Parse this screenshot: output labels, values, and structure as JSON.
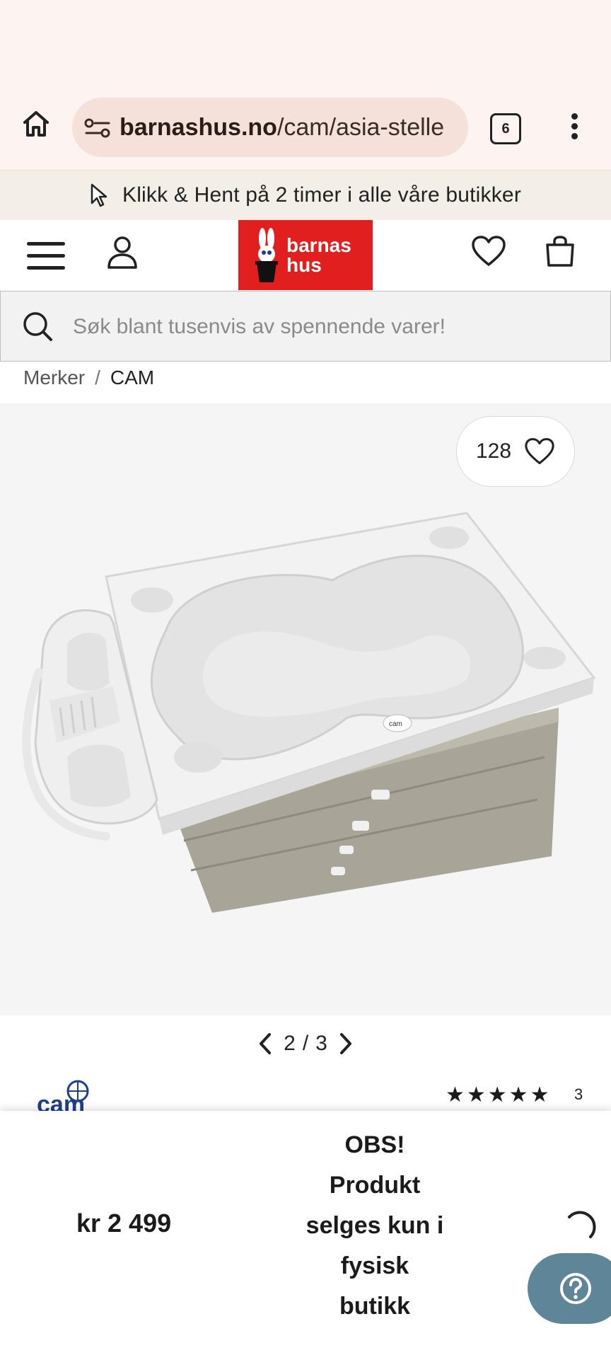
{
  "browser": {
    "url_host": "barnashus.no",
    "url_path": "/cam/asia-stelle",
    "tab_count": "6"
  },
  "promo": {
    "text": "Klikk & Hent på 2 timer i alle våre butikker"
  },
  "header": {
    "logo_line1": "barnas",
    "logo_line2": "hus"
  },
  "search": {
    "placeholder": "Søk blant tusenvis av spennende varer!"
  },
  "breadcrumb": {
    "items": [
      "Merker",
      "CAM"
    ],
    "separator": "/"
  },
  "product": {
    "favorites_count": "128",
    "pager_current": "2",
    "pager_separator": "/",
    "pager_total": "3",
    "brand": "cam",
    "rating_stars": "★★★★★",
    "rating_value": 5,
    "rating_count": "3"
  },
  "buybar": {
    "price": "kr 2 499",
    "notice_lines": [
      "OBS!",
      "Produkt",
      "selges kun i",
      "fysisk",
      "butikk"
    ]
  },
  "colors": {
    "brand_red": "#e21f1f",
    "help_button": "#5f8599",
    "chrome_bg": "#fdf3f0",
    "promo_bg": "#f3efe8"
  },
  "icons": [
    "home-icon",
    "site-settings-icon",
    "tabs-icon",
    "more-vert-icon",
    "cursor-icon",
    "hamburger-icon",
    "user-icon",
    "heart-icon",
    "bag-icon",
    "search-icon",
    "chevron-left-icon",
    "chevron-right-icon",
    "star-icon",
    "spinner-icon",
    "help-icon"
  ]
}
